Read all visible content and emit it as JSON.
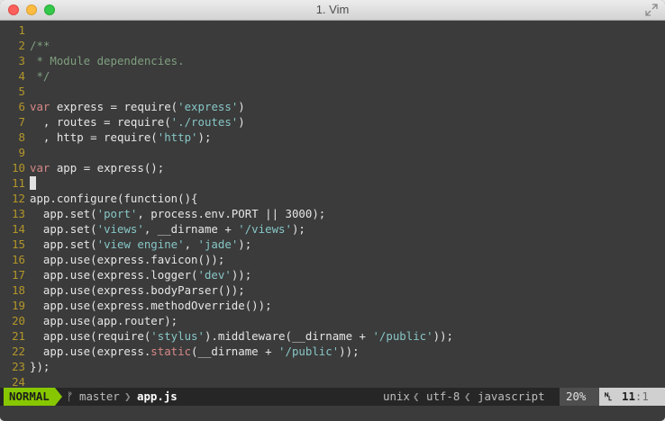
{
  "window": {
    "title": "1. Vim"
  },
  "editor": {
    "lines": [
      {
        "n": "1",
        "t": []
      },
      {
        "n": "2",
        "t": [
          {
            "c": "cm",
            "s": "/**"
          }
        ]
      },
      {
        "n": "3",
        "t": [
          {
            "c": "cm",
            "s": " * Module dependencies."
          }
        ]
      },
      {
        "n": "4",
        "t": [
          {
            "c": "cm",
            "s": " */"
          }
        ]
      },
      {
        "n": "5",
        "t": []
      },
      {
        "n": "6",
        "t": [
          {
            "c": "kw",
            "s": "var"
          },
          {
            "c": "",
            "s": " express = require("
          },
          {
            "c": "st",
            "s": "'express'"
          },
          {
            "c": "",
            "s": ")"
          }
        ]
      },
      {
        "n": "7",
        "t": [
          {
            "c": "",
            "s": "  , routes = require("
          },
          {
            "c": "st",
            "s": "'./routes'"
          },
          {
            "c": "",
            "s": ")"
          }
        ]
      },
      {
        "n": "8",
        "t": [
          {
            "c": "",
            "s": "  , http = require("
          },
          {
            "c": "st",
            "s": "'http'"
          },
          {
            "c": "",
            "s": ");"
          }
        ]
      },
      {
        "n": "9",
        "t": []
      },
      {
        "n": "10",
        "t": [
          {
            "c": "kw",
            "s": "var"
          },
          {
            "c": "",
            "s": " app = express();"
          }
        ]
      },
      {
        "n": "11",
        "t": [],
        "cursor": true
      },
      {
        "n": "12",
        "t": [
          {
            "c": "",
            "s": "app.configure(function(){"
          }
        ]
      },
      {
        "n": "13",
        "t": [
          {
            "c": "",
            "s": "  app.set("
          },
          {
            "c": "st",
            "s": "'port'"
          },
          {
            "c": "",
            "s": ", process.env.PORT || 3000);"
          }
        ]
      },
      {
        "n": "14",
        "t": [
          {
            "c": "",
            "s": "  app.set("
          },
          {
            "c": "st",
            "s": "'views'"
          },
          {
            "c": "",
            "s": ", __dirname + "
          },
          {
            "c": "st",
            "s": "'/views'"
          },
          {
            "c": "",
            "s": ");"
          }
        ]
      },
      {
        "n": "15",
        "t": [
          {
            "c": "",
            "s": "  app.set("
          },
          {
            "c": "st",
            "s": "'view engine'"
          },
          {
            "c": "",
            "s": ", "
          },
          {
            "c": "st",
            "s": "'jade'"
          },
          {
            "c": "",
            "s": ");"
          }
        ]
      },
      {
        "n": "16",
        "t": [
          {
            "c": "",
            "s": "  app.use(express.favicon());"
          }
        ]
      },
      {
        "n": "17",
        "t": [
          {
            "c": "",
            "s": "  app.use(express.logger("
          },
          {
            "c": "st",
            "s": "'dev'"
          },
          {
            "c": "",
            "s": "));"
          }
        ]
      },
      {
        "n": "18",
        "t": [
          {
            "c": "",
            "s": "  app.use(express.bodyParser());"
          }
        ]
      },
      {
        "n": "19",
        "t": [
          {
            "c": "",
            "s": "  app.use(express.methodOverride());"
          }
        ]
      },
      {
        "n": "20",
        "t": [
          {
            "c": "",
            "s": "  app.use(app.router);"
          }
        ]
      },
      {
        "n": "21",
        "t": [
          {
            "c": "",
            "s": "  app.use(require("
          },
          {
            "c": "st",
            "s": "'stylus'"
          },
          {
            "c": "",
            "s": ").middleware(__dirname + "
          },
          {
            "c": "st",
            "s": "'/public'"
          },
          {
            "c": "",
            "s": "));"
          }
        ]
      },
      {
        "n": "22",
        "t": [
          {
            "c": "",
            "s": "  app.use(express."
          },
          {
            "c": "kw",
            "s": "static"
          },
          {
            "c": "",
            "s": "(__dirname + "
          },
          {
            "c": "st",
            "s": "'/public'"
          },
          {
            "c": "",
            "s": "));"
          }
        ]
      },
      {
        "n": "23",
        "t": [
          {
            "c": "",
            "s": "});"
          }
        ]
      },
      {
        "n": "24",
        "t": []
      }
    ]
  },
  "statusline": {
    "mode": "NORMAL",
    "branch": "master",
    "file": "app.js",
    "fileformat": "unix",
    "encoding": "utf-8",
    "filetype": "javascript",
    "percent": "20%",
    "line": "11",
    "col": ":1",
    "colors": {
      "mode_bg": "#87c700",
      "linenr": "#b3962a",
      "string": "#87c6c6",
      "keyword": "#d78787",
      "comment": "#7f9f7f"
    }
  }
}
